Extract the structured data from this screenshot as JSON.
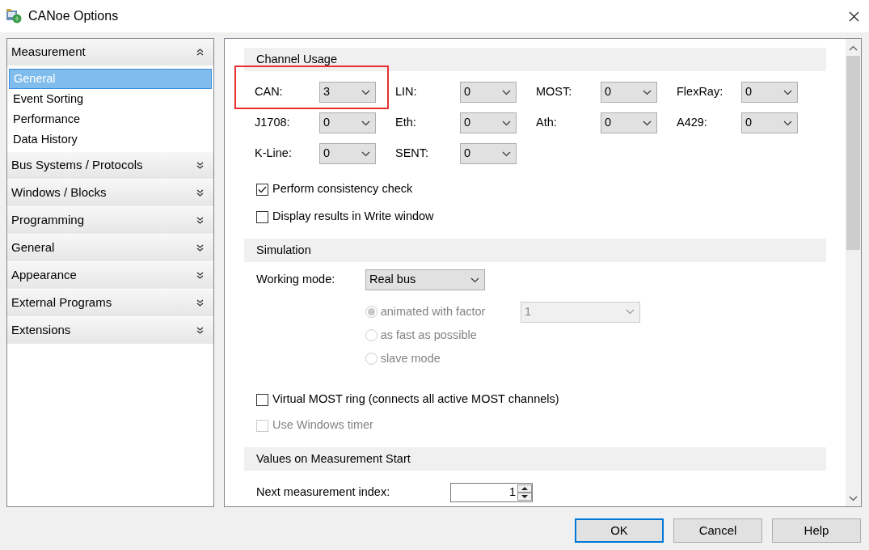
{
  "window": {
    "title": "CANoe Options"
  },
  "sidebar": {
    "groups": [
      {
        "label": "Measurement",
        "expanded": true,
        "items": [
          {
            "label": "General",
            "selected": true
          },
          {
            "label": "Event Sorting",
            "selected": false
          },
          {
            "label": "Performance",
            "selected": false
          },
          {
            "label": "Data History",
            "selected": false
          }
        ]
      },
      {
        "label": "Bus Systems / Protocols",
        "expanded": false
      },
      {
        "label": "Windows / Blocks",
        "expanded": false
      },
      {
        "label": "Programming",
        "expanded": false
      },
      {
        "label": "General",
        "expanded": false
      },
      {
        "label": "Appearance",
        "expanded": false
      },
      {
        "label": "External Programs",
        "expanded": false
      },
      {
        "label": "Extensions",
        "expanded": false
      }
    ]
  },
  "channel_usage": {
    "title": "Channel Usage",
    "channels": [
      {
        "label": "CAN:",
        "value": "3",
        "highlighted": true
      },
      {
        "label": "LIN:",
        "value": "0",
        "highlighted": false
      },
      {
        "label": "MOST:",
        "value": "0",
        "highlighted": false
      },
      {
        "label": "FlexRay:",
        "value": "0",
        "highlighted": false
      },
      {
        "label": "J1708:",
        "value": "0",
        "highlighted": false
      },
      {
        "label": "Eth:",
        "value": "0",
        "highlighted": false
      },
      {
        "label": "Ath:",
        "value": "0",
        "highlighted": false
      },
      {
        "label": "A429:",
        "value": "0",
        "highlighted": false
      },
      {
        "label": "K-Line:",
        "value": "0",
        "highlighted": false
      },
      {
        "label": "SENT:",
        "value": "0",
        "highlighted": false
      }
    ],
    "options": [
      {
        "label": "Perform consistency check",
        "checked": true,
        "disabled": false
      },
      {
        "label": "Display results in Write window",
        "checked": false,
        "disabled": false
      }
    ]
  },
  "simulation": {
    "title": "Simulation",
    "working_mode": {
      "label": "Working mode:",
      "value": "Real bus"
    },
    "modes": [
      {
        "label": "animated with factor",
        "selected": true,
        "disabled": true
      },
      {
        "label": "as fast as possible",
        "selected": false,
        "disabled": true
      },
      {
        "label": "slave mode",
        "selected": false,
        "disabled": true
      }
    ],
    "factor": {
      "value": "1",
      "disabled": true
    },
    "options": [
      {
        "label": "Virtual MOST ring (connects all active MOST channels)",
        "checked": false,
        "disabled": false
      },
      {
        "label": "Use Windows timer",
        "checked": false,
        "disabled": true
      }
    ]
  },
  "measurement_start": {
    "title": "Values on Measurement Start",
    "index": {
      "label": "Next measurement index:",
      "value": "1"
    }
  },
  "buttons": [
    {
      "label": "OK",
      "default": true
    },
    {
      "label": "Cancel",
      "default": false
    },
    {
      "label": "Help",
      "default": false
    }
  ]
}
